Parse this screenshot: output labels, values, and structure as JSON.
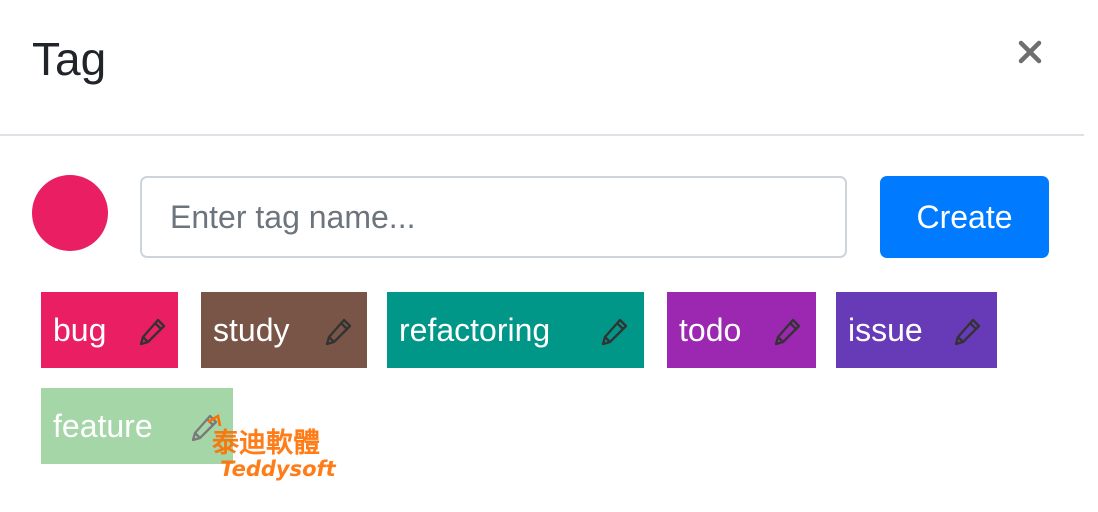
{
  "dialog": {
    "title": "Tag",
    "close_icon": "close-icon"
  },
  "form": {
    "color": "#e91e63",
    "input": {
      "value": "",
      "placeholder": "Enter tag name..."
    },
    "create_label": "Create",
    "create_color": "#007bff"
  },
  "tags": [
    {
      "label": "bug",
      "color": "#e91e63",
      "icon": "pencil-icon"
    },
    {
      "label": "study",
      "color": "#795548",
      "icon": "pencil-icon"
    },
    {
      "label": "refactoring",
      "color": "#009688",
      "icon": "pencil-icon"
    },
    {
      "label": "todo",
      "color": "#9c27b0",
      "icon": "pencil-icon"
    },
    {
      "label": "issue",
      "color": "#673ab7",
      "icon": "pencil-icon"
    },
    {
      "label": "feature",
      "color": "#a5d6a7",
      "icon": "pencil-icon"
    }
  ],
  "watermark": {
    "text_cn": "泰迪軟體",
    "text_en": "Teddysoft",
    "color": "#ff6f00"
  }
}
